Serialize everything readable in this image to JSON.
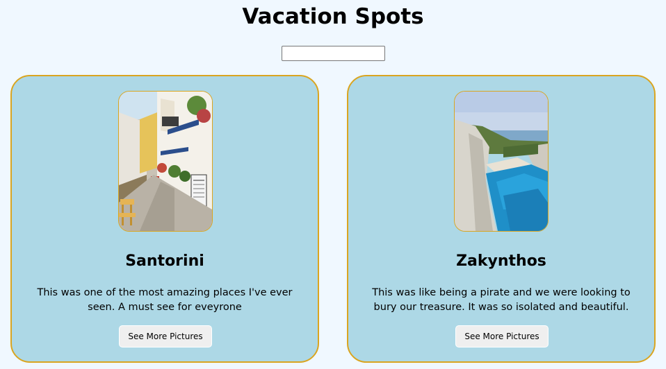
{
  "page": {
    "title": "Vacation Spots",
    "search": {
      "value": "",
      "placeholder": ""
    }
  },
  "cards": [
    {
      "title": "Santorini",
      "description": "This was one of the most amazing places I've ever seen. A must see for eveyrone",
      "button_label": "See More Pictures",
      "image": "street-photo"
    },
    {
      "title": "Zakynthos",
      "description": "This was like being a pirate and we were looking to bury our treasure. It was so isolated and beautiful.",
      "button_label": "See More Pictures",
      "image": "cove-photo"
    }
  ],
  "colors": {
    "background": "#f0f8ff",
    "card_fill": "#add8e6",
    "card_border": "#daa520",
    "button_fill": "#efefef"
  }
}
